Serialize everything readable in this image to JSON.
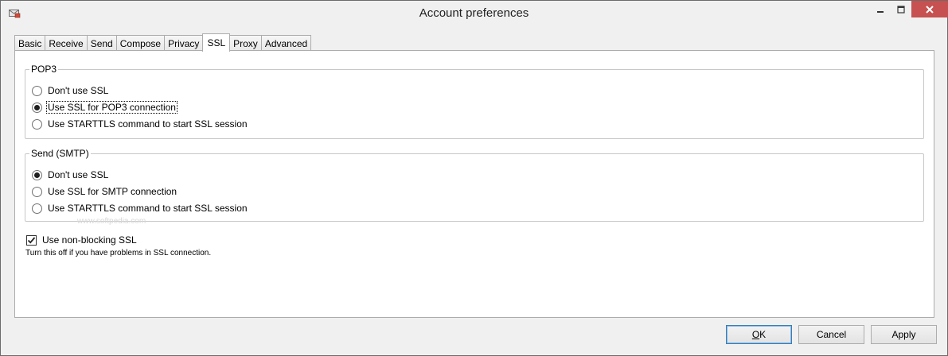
{
  "window": {
    "title": "Account preferences"
  },
  "tabs": [
    {
      "label": "Basic",
      "active": false
    },
    {
      "label": "Receive",
      "active": false
    },
    {
      "label": "Send",
      "active": false
    },
    {
      "label": "Compose",
      "active": false
    },
    {
      "label": "Privacy",
      "active": false
    },
    {
      "label": "SSL",
      "active": true
    },
    {
      "label": "Proxy",
      "active": false
    },
    {
      "label": "Advanced",
      "active": false
    }
  ],
  "pop3": {
    "title": "POP3",
    "options": [
      {
        "label": "Don't use SSL",
        "selected": false
      },
      {
        "label": "Use SSL for POP3 connection",
        "selected": true
      },
      {
        "label": "Use STARTTLS command to start SSL session",
        "selected": false
      }
    ]
  },
  "smtp": {
    "title": "Send (SMTP)",
    "options": [
      {
        "label": "Don't use SSL",
        "selected": true
      },
      {
        "label": "Use SSL for SMTP connection",
        "selected": false
      },
      {
        "label": "Use STARTTLS command to start SSL session",
        "selected": false
      }
    ]
  },
  "nonblocking": {
    "label": "Use non-blocking SSL",
    "checked": true,
    "hint": "Turn this off if you have problems in SSL connection."
  },
  "watermark": "www.softpedia.com",
  "buttons": {
    "ok_mnemonic": "O",
    "ok_rest": "K",
    "cancel_label": "Cancel",
    "apply_label": "Apply"
  }
}
